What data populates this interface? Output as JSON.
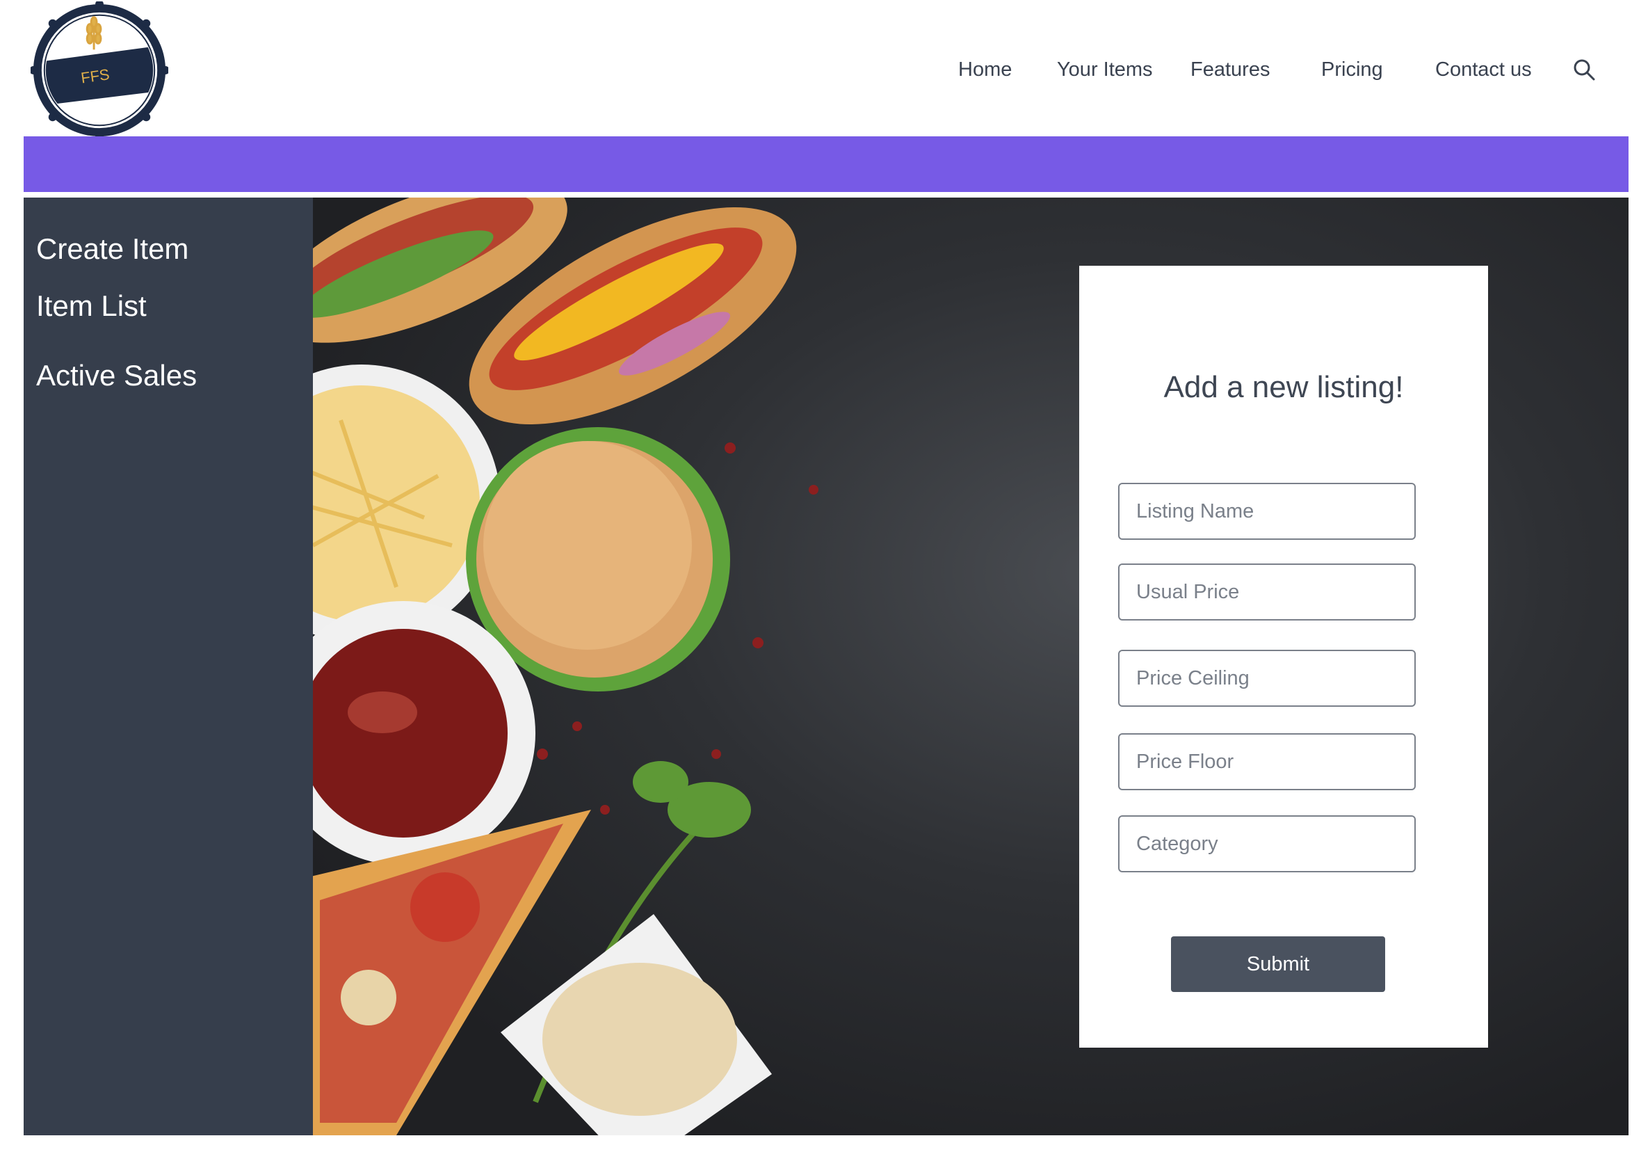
{
  "header": {
    "logo_text": "FFS",
    "nav": [
      {
        "label": "Home"
      },
      {
        "label": "Your Items"
      },
      {
        "label": "Features"
      },
      {
        "label": "Pricing"
      },
      {
        "label": "Contact us"
      }
    ],
    "search_icon": "search-icon"
  },
  "colors": {
    "band": "#775ae6",
    "sidebar": "#363e4c",
    "submit": "#4a525f"
  },
  "sidebar": {
    "items": [
      {
        "label": "Create Item"
      },
      {
        "label": "Item List"
      },
      {
        "label": "Active Sales"
      }
    ]
  },
  "form": {
    "title": "Add a new listing!",
    "fields": [
      {
        "placeholder": "Listing Name",
        "value": ""
      },
      {
        "placeholder": "Usual Price",
        "value": ""
      },
      {
        "placeholder": "Price Ceiling",
        "value": ""
      },
      {
        "placeholder": "Price Floor",
        "value": ""
      },
      {
        "placeholder": "Category",
        "value": ""
      }
    ],
    "submit_label": "Submit"
  }
}
